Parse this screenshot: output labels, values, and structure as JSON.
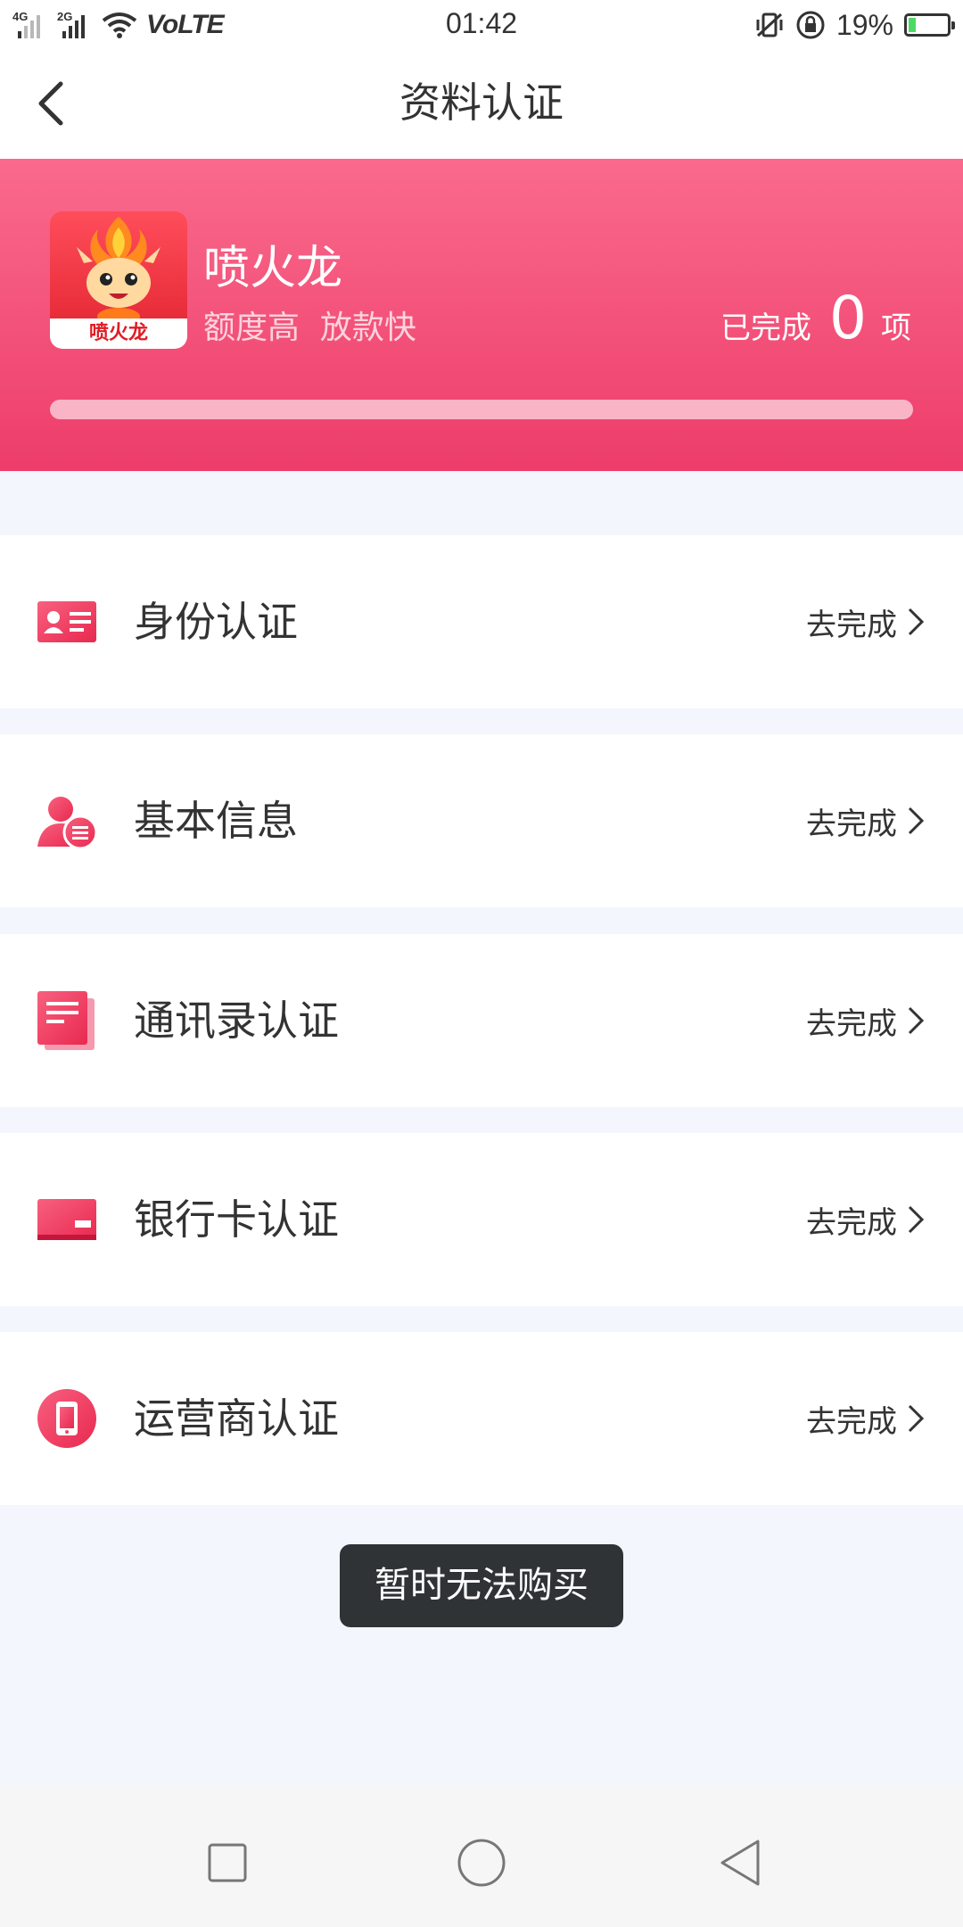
{
  "status_bar": {
    "sim1_tag": "4G",
    "sim2_tag": "2G",
    "network": "VoLTE",
    "time": "01:42",
    "battery_percent": "19%",
    "battery_level": 0.19,
    "icons": [
      "signal-icon",
      "wifi-icon",
      "vibrate-icon",
      "rotation-lock-icon",
      "battery-charging-icon"
    ]
  },
  "header": {
    "title": "资料认证",
    "back_icon": "chevron-left-icon"
  },
  "banner": {
    "brand_name": "喷火龙",
    "slogan": "额度高  放款快",
    "logo_text": "喷火龙",
    "completed_label": "已完成",
    "completed_count": "0",
    "completed_unit": "项",
    "progress": 0,
    "colors": {
      "gradient_top": "#fa6a8c",
      "gradient_bottom": "#ed3d6a"
    }
  },
  "items": [
    {
      "label": "身份认证",
      "action": "去完成",
      "icon": "id-card-icon"
    },
    {
      "label": "基本信息",
      "action": "去完成",
      "icon": "user-info-icon"
    },
    {
      "label": "通讯录认证",
      "action": "去完成",
      "icon": "contacts-book-icon"
    },
    {
      "label": "银行卡认证",
      "action": "去完成",
      "icon": "bank-card-icon"
    },
    {
      "label": "运营商认证",
      "action": "去完成",
      "icon": "phone-carrier-icon"
    }
  ],
  "toast": {
    "text": "暂时无法购买"
  },
  "nav": {
    "icons": [
      "recents-square-icon",
      "home-circle-icon",
      "back-triangle-icon"
    ]
  },
  "colors": {
    "accent": "#ec3c68",
    "background": "#f3f6fc"
  }
}
